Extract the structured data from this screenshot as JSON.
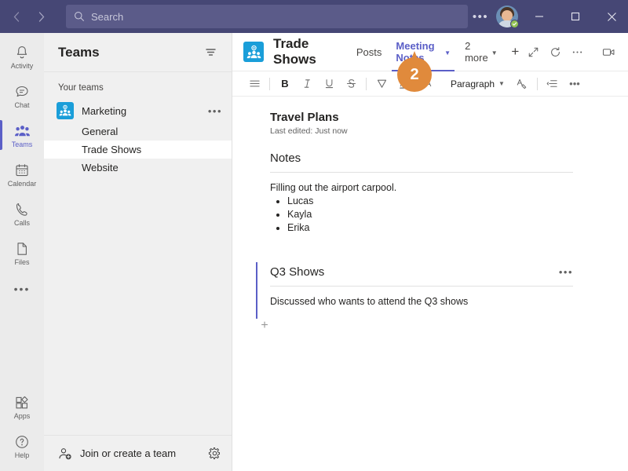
{
  "titlebar": {
    "back_icon": "chevron-left-icon",
    "forward_icon": "chevron-right-icon",
    "search": {
      "placeholder": "Search",
      "value": "",
      "icon": "search-icon"
    },
    "more_label": "•••",
    "avatar_alt": "User avatar",
    "presence": "available",
    "minimize_label": "─",
    "maximize_label": "□",
    "close_label": "✕",
    "bg_color": "#464775"
  },
  "rail": {
    "items": [
      {
        "label": "Activity",
        "icon": "bell-icon",
        "active": false
      },
      {
        "label": "Chat",
        "icon": "chat-bubble-icon",
        "active": false
      },
      {
        "label": "Teams",
        "icon": "people-icon",
        "active": true
      },
      {
        "label": "Calendar",
        "icon": "calendar-icon",
        "active": false
      },
      {
        "label": "Calls",
        "icon": "phone-icon",
        "active": false
      },
      {
        "label": "Files",
        "icon": "file-icon",
        "active": false
      }
    ],
    "more_label": "•••",
    "bottom": [
      {
        "label": "Apps",
        "icon": "apps-icon"
      },
      {
        "label": "Help",
        "icon": "help-icon"
      }
    ],
    "accent_color": "#5b5fc7"
  },
  "teams_panel": {
    "title": "Teams",
    "filter_icon": "filter-icon",
    "section_label": "Your teams",
    "team": {
      "name": "Marketing",
      "icon": "team-avatar-icon",
      "more_label": "•••",
      "avatar_color": "#1a9ed9"
    },
    "channels": [
      {
        "name": "General",
        "selected": false
      },
      {
        "name": "Trade Shows",
        "selected": true
      },
      {
        "name": "Website",
        "selected": false
      }
    ],
    "join_label": "Join or create a team",
    "join_icon": "add-person-icon",
    "settings_icon": "gear-icon"
  },
  "channel_header": {
    "icon": "team-avatar-icon",
    "title": "Trade Shows",
    "tabs": [
      {
        "label": "Posts",
        "active": false,
        "has_caret": false
      },
      {
        "label": "Meeting Notes",
        "active": true,
        "has_caret": true
      },
      {
        "label": "2 more",
        "active": false,
        "has_caret": true
      }
    ],
    "add_tab_label": "+",
    "actions": [
      {
        "icon": "open-in-new-icon"
      },
      {
        "icon": "refresh-icon"
      },
      {
        "icon": "more-options-icon"
      },
      {
        "icon": "video-camera-icon"
      }
    ],
    "accent_color": "#5b5fc7"
  },
  "editor_toolbar": {
    "buttons": [
      {
        "icon": "format-lines-icon",
        "label": "≡",
        "strong": false
      },
      {
        "icon": "bold-icon",
        "label": "B",
        "strong": true
      },
      {
        "icon": "italic-icon",
        "label": "I",
        "strong": false
      },
      {
        "icon": "underline-icon",
        "label": "U",
        "strong": false
      },
      {
        "icon": "strikethrough-icon",
        "label": "S",
        "strong": false
      },
      {
        "icon": "highlight-icon",
        "label": "∇",
        "strong": false
      },
      {
        "icon": "font-color-icon",
        "label": "A",
        "strong": false
      },
      {
        "icon": "font-size-icon",
        "label": "AA",
        "strong": false
      }
    ],
    "paragraph_label": "Paragraph",
    "paragraph_caret": "chevron-down-icon",
    "clear_format_icon": "clear-formatting-icon",
    "list_icon": "list-indent-icon",
    "more_label": "•••"
  },
  "callout_badge": {
    "number": "2",
    "color": "#E08A3C"
  },
  "document": {
    "title": "Travel Plans",
    "last_edited": "Last edited: Just now",
    "sections": [
      {
        "heading": "Notes",
        "selected": false,
        "more_label": "",
        "paragraph": "Filling out the airport carpool.",
        "bullets": [
          "Lucas",
          "Kayla",
          "Erika"
        ]
      },
      {
        "heading": "Q3 Shows",
        "selected": true,
        "more_label": "•••",
        "paragraph": "Discussed who wants to attend the Q3 shows",
        "bullets": []
      }
    ],
    "add_block_label": "+"
  }
}
